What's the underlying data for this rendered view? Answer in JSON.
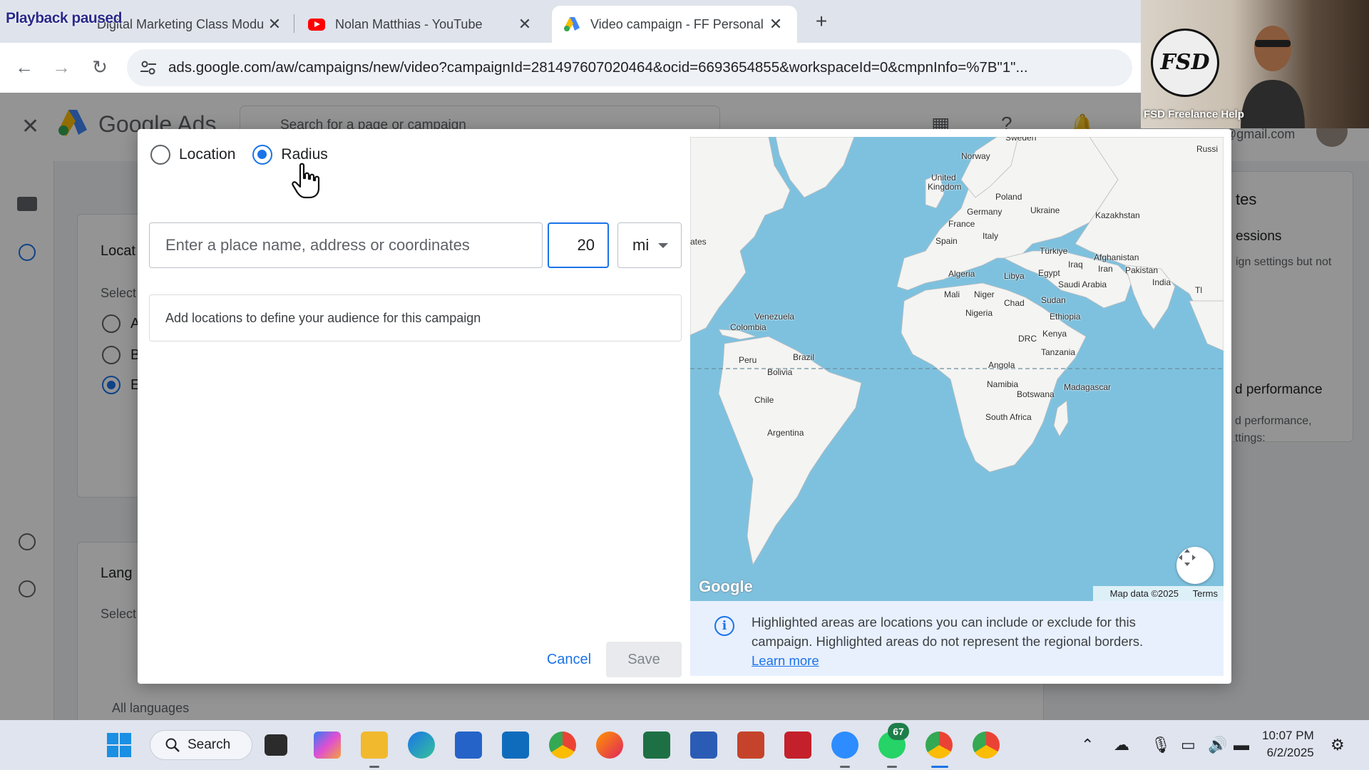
{
  "browser": {
    "overlay_text": "Playback paused",
    "tabs": [
      {
        "title": "Digital Marketing Class Module",
        "active": false
      },
      {
        "title": "Nolan Matthias - YouTube",
        "active": false
      },
      {
        "title": "Video campaign - FF Personal -",
        "active": true
      }
    ],
    "url": "ads.google.com/aw/campaigns/new/video?campaignId=281497607020464&ocid=6693654855&workspaceId=0&cmpnInfo=%7B\"1\"..."
  },
  "background_page": {
    "logo_text": "Google Ads",
    "search_placeholder": "Search for a page or campaign",
    "account_email": "@gmail.com",
    "section_location": "Locat",
    "section_select": "Select",
    "section_language": "Lang",
    "section_language_select": "Select",
    "language_value": "All languages",
    "radio_a": "A",
    "radio_b": "B",
    "radio_e": "E",
    "right_panel_heading": "tes",
    "right_panel_sessions": "essions",
    "right_panel_sessions_text": "ign settings but not",
    "right_panel_perf": "d performance",
    "right_panel_perf_text1": "d performance,",
    "right_panel_perf_text2": "ttings:"
  },
  "modal": {
    "radio_location": "Location",
    "radio_radius": "Radius",
    "selected_mode": "Radius",
    "place_placeholder": "Enter a place name, address or coordinates",
    "radius_value": "20",
    "unit": "mi",
    "empty_message": "Add locations to define your audience for this campaign",
    "cancel_label": "Cancel",
    "save_label": "Save",
    "map": {
      "watermark": "Google",
      "map_data": "Map data ©2025",
      "terms": "Terms",
      "labels": {
        "sweden": "Sweden",
        "russia": "Russi",
        "norway": "Norway",
        "uk1": "United",
        "uk2": "Kingdom",
        "poland": "Poland",
        "germany": "Germany",
        "ukraine": "Ukraine",
        "kazakhstan": "Kazakhstan",
        "france": "France",
        "italy": "Italy",
        "spain": "Spain",
        "turkiye": "Türkiye",
        "states": "ates",
        "afghanistan": "Afghanistan",
        "iraq": "Iraq",
        "iran": "Iran",
        "pakistan": "Pakistan",
        "algeria": "Algeria",
        "libya": "Libya",
        "egypt": "Egypt",
        "saudi": "Saudi Arabia",
        "india": "India",
        "mali": "Mali",
        "niger": "Niger",
        "chad": "Chad",
        "sudan": "Sudan",
        "nigeria": "Nigeria",
        "ethiopia": "Ethiopia",
        "venezuela": "Venezuela",
        "colombia": "Colombia",
        "kenya": "Kenya",
        "drc": "DRC",
        "tanzania": "Tanzania",
        "brazil": "Brazil",
        "peru": "Peru",
        "bolivia": "Bolivia",
        "angola": "Angola",
        "namibia": "Namibia",
        "botswana": "Botswana",
        "madagascar": "Madagascar",
        "chile": "Chile",
        "south_africa": "South Africa",
        "argentina": "Argentina",
        "thai": "Tl"
      }
    },
    "note_text": "Highlighted areas are locations you can include or exclude for this campaign. Highlighted areas do not represent the regional borders.",
    "note_link": "Learn more"
  },
  "webcam": {
    "logo_text": "FSD",
    "name": "FSD Freelance Help"
  },
  "taskbar": {
    "search_label": "Search",
    "whatsapp_badge": "67",
    "time": "10:07 PM",
    "date": "6/2/2025"
  }
}
